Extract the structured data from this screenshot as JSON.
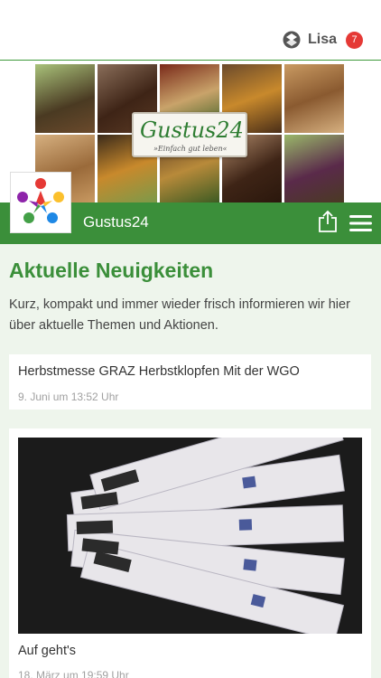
{
  "header": {
    "user_icon": "brand-logo-icon",
    "user_name": "Lisa",
    "notification_count": "7",
    "badge_color": "#e53935"
  },
  "banner": {
    "brand_name": "Gustus24",
    "tagline": "»Einfach gut leben«"
  },
  "nav": {
    "title": "Gustus24",
    "share_icon": "share-icon",
    "menu_icon": "hamburger-menu-icon",
    "color": "#3b8f3a"
  },
  "main": {
    "section_title": "Aktuelle Neuigkeiten",
    "intro": "Kurz, kompakt und immer wieder frisch informieren wir hier über aktuelle Themen und Aktionen.",
    "news": [
      {
        "title": "Herbstmesse GRAZ Herbstklopfen Mit der WGO",
        "date": "9. Juni um 13:52 Uhr"
      },
      {
        "title": "Auf geht's",
        "date": "18. März um 19:59 Uhr"
      }
    ]
  }
}
